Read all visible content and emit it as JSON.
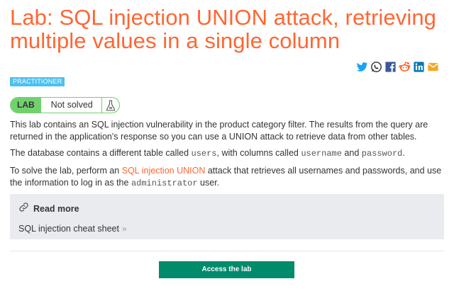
{
  "page": {
    "title": "Lab: SQL injection UNION attack, retrieving multiple values in a single column"
  },
  "share_icons": [
    "twitter-icon",
    "whatsapp-icon",
    "facebook-icon",
    "reddit-icon",
    "linkedin-icon",
    "email-icon"
  ],
  "level_badge": "PRACTITIONER",
  "lab_status": {
    "tag": "LAB",
    "state": "Not solved",
    "icon": "flask-icon"
  },
  "description": {
    "p1": "This lab contains an SQL injection vulnerability in the product category filter. The results from the query are returned in the application's response so you can use a UNION attack to retrieve data from other tables.",
    "p2_a": "The database contains a different table called ",
    "p2_code1": "users",
    "p2_b": ", with columns called ",
    "p2_code2": "username",
    "p2_c": " and ",
    "p2_code3": "password",
    "p2_d": ".",
    "p3_a": "To solve the lab, perform an ",
    "p3_link": "SQL injection UNION",
    "p3_b": " attack that retrieves all usernames and passwords, and use the information to log in as the ",
    "p3_code": "administrator",
    "p3_c": " user."
  },
  "read_more": {
    "title": "Read more",
    "link": "SQL injection cheat sheet",
    "arrow": "»"
  },
  "access_button": "Access the lab",
  "colors": {
    "title": "#ff6633",
    "badge": "#4cc1f0",
    "lab_green": "#70d16d",
    "button": "#008b6b"
  }
}
